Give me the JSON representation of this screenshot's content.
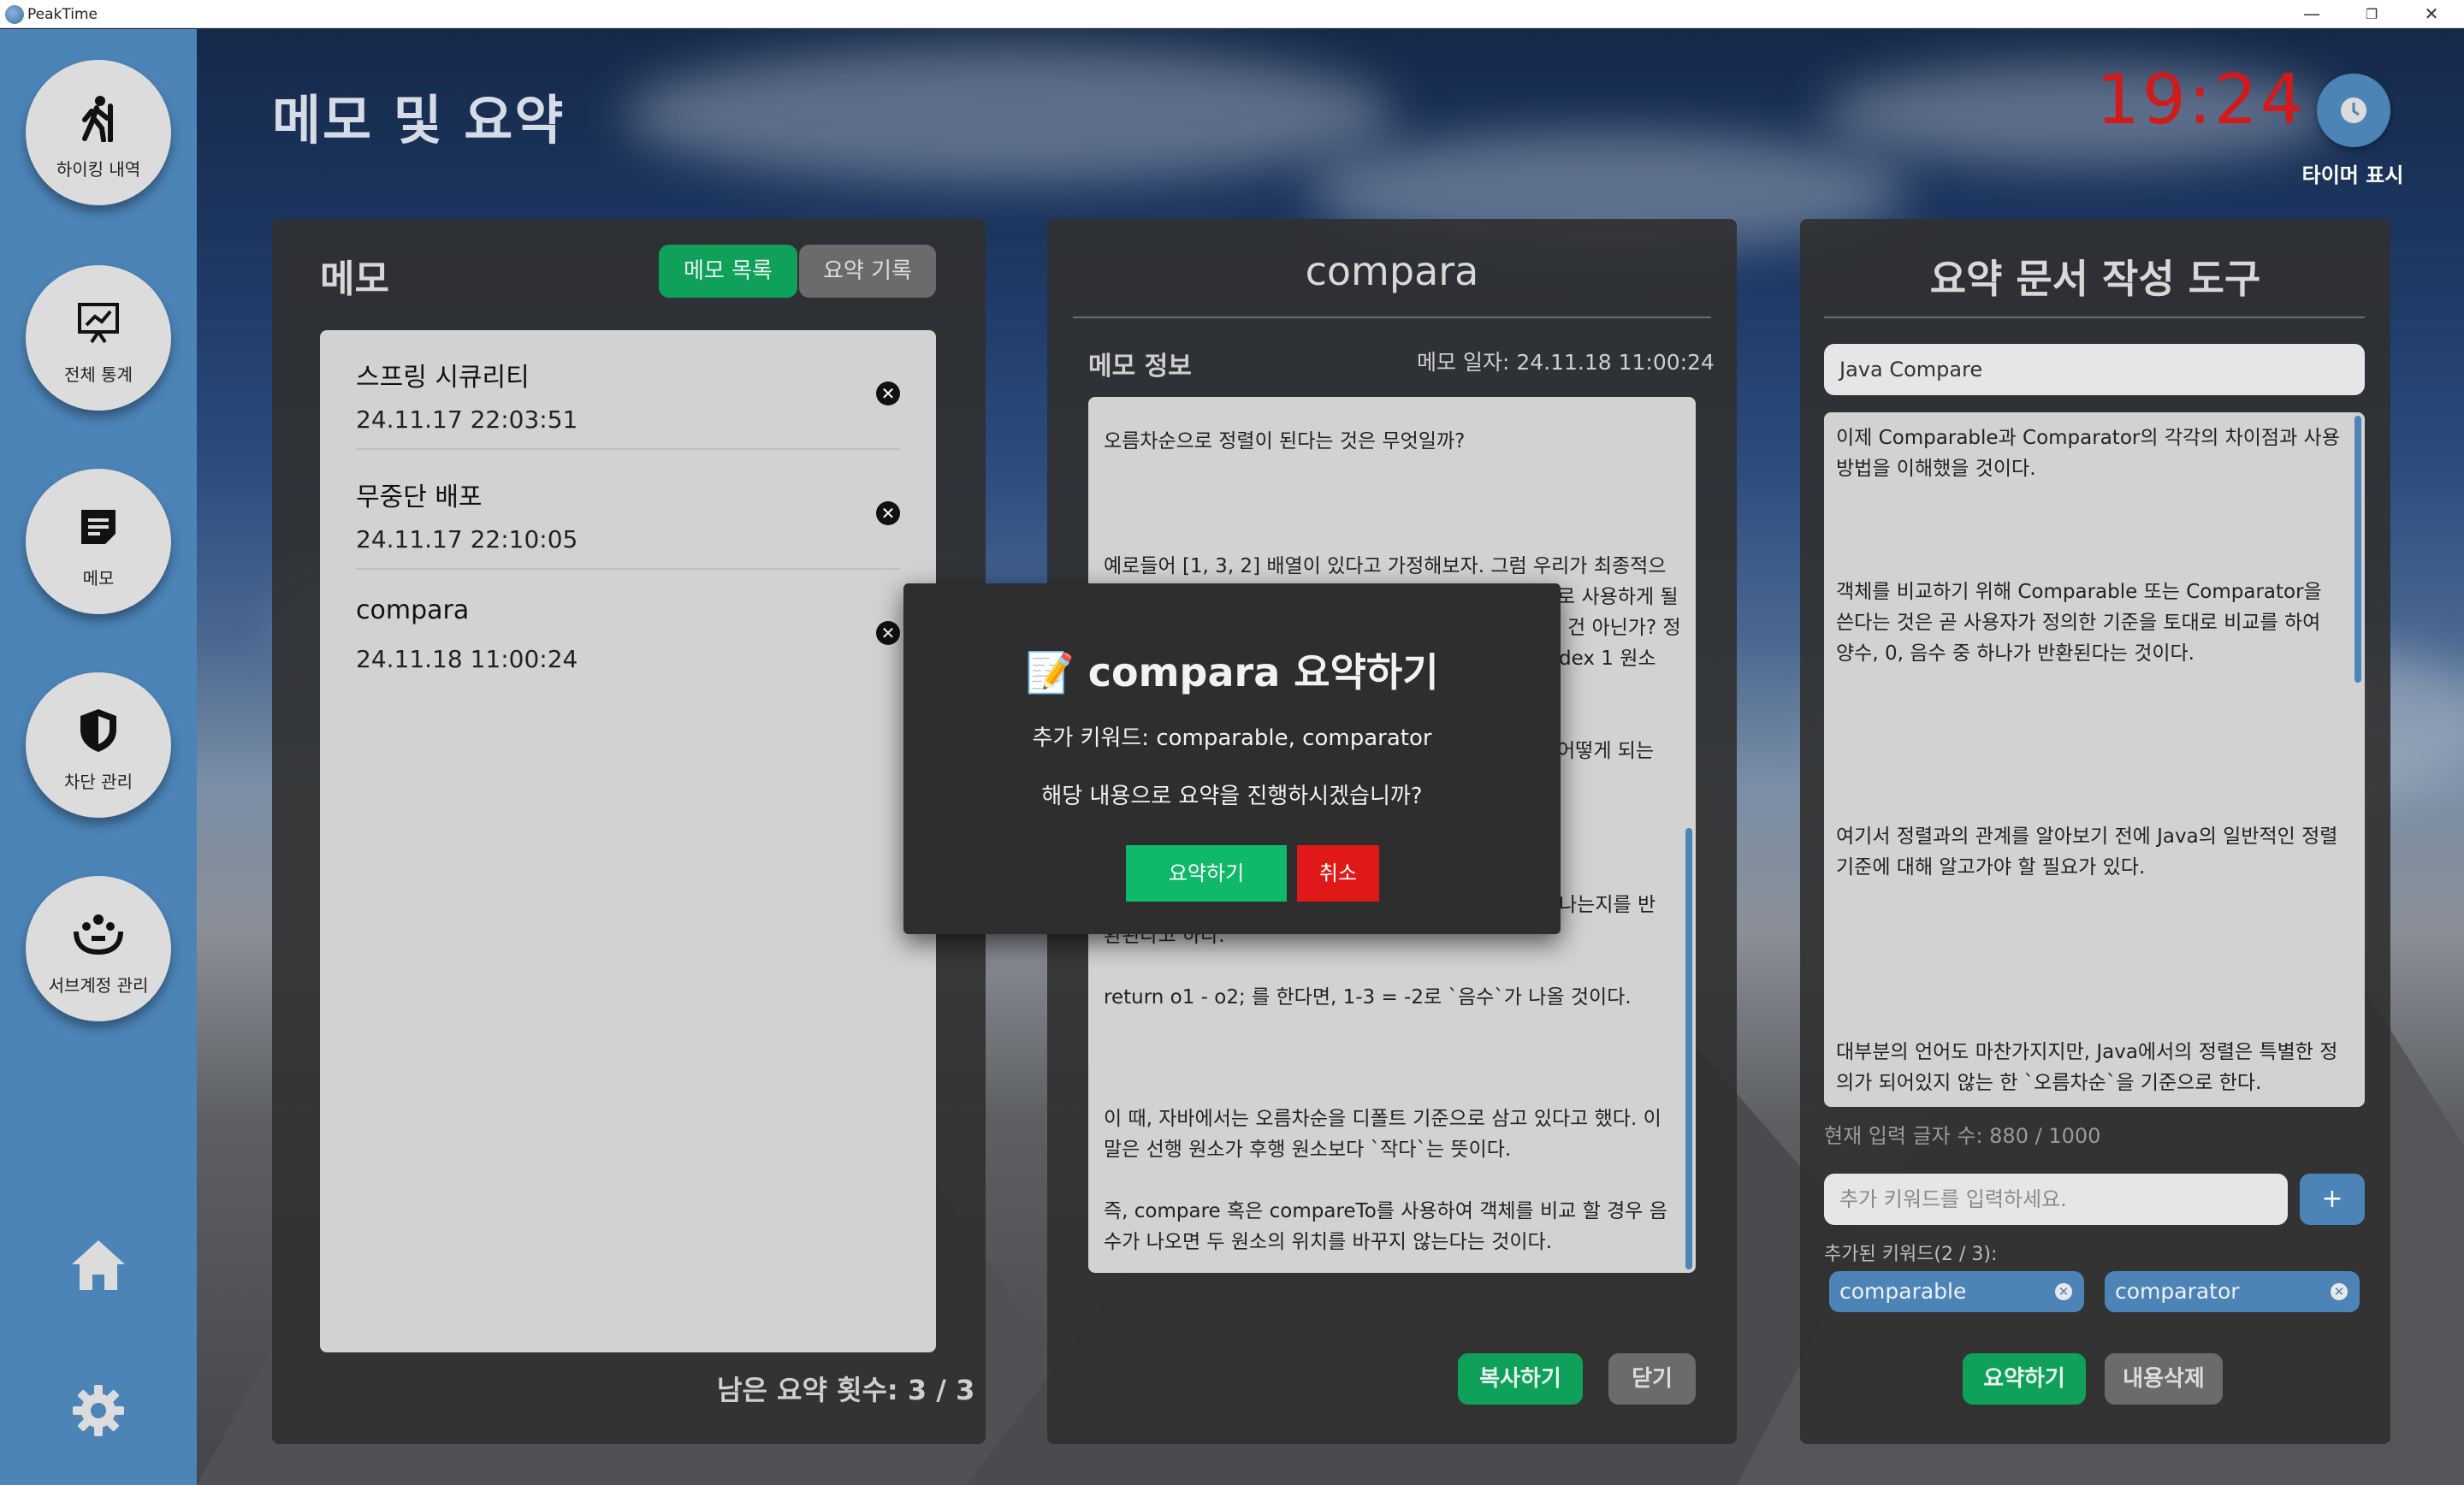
{
  "app": {
    "title": "PeakTime"
  },
  "window_controls": {
    "minimize": "—",
    "restore": "❐",
    "close": "✕"
  },
  "sidebar": {
    "items": [
      {
        "label": "하이킹 내역",
        "icon": "hiker-icon"
      },
      {
        "label": "전체 통계",
        "icon": "chart-board-icon"
      },
      {
        "label": "메모",
        "icon": "memo-icon"
      },
      {
        "label": "차단 관리",
        "icon": "shield-icon"
      },
      {
        "label": "서브계정 관리",
        "icon": "group-hands-icon"
      }
    ],
    "bottom": [
      {
        "icon": "home-icon"
      },
      {
        "icon": "gear-icon"
      }
    ]
  },
  "header": {
    "title": "메모 및 요약",
    "clock": "19:24",
    "timer_label": "타이머 표시",
    "clock_color": "#d11a1a"
  },
  "memo_panel": {
    "title": "메모",
    "tabs": [
      {
        "label": "메모 목록",
        "active": true
      },
      {
        "label": "요약 기록",
        "active": false
      }
    ],
    "items": [
      {
        "title": "스프링 시큐리티",
        "date": "24.11.17 22:03:51"
      },
      {
        "title": "무중단 배포",
        "date": "24.11.17 22:10:05"
      },
      {
        "title": "compara",
        "date": "24.11.18 11:00:24"
      }
    ],
    "delete_symbol": "✕",
    "remaining": "남은 요약 횟수: 3 / 3"
  },
  "detail_panel": {
    "title": "compara",
    "info_label": "메모 정보",
    "date": "메모 일자: 24.11.18 11:00:24",
    "paragraphs": [
      "오름차순으로 정렬이 된다는 것은 무엇일까?",
      "예로들어 [1, 3, 2] 배열이 있다고 가정해보자. 그럼 우리가 최종적으",
      "로 사용하게 될",
      "건 아닌가? 정",
      "dex 1 원소",
      "어떻게 되는",
      "나는지를 반",
      "환된다고 하다.",
      "return o1 - o2; 를 한다면, 1-3 = -2로 `음수`가 나올 것이다.",
      "이 때, 자바에서는 오름차순을 디폴트 기준으로 삼고 있다고 했다. 이 말은 선행 원소가 후행 원소보다 `작다`는 뜻이다.",
      "즉, compare 혹은 compareTo를 사용하여 객체를 비교 할 경우 음수가 나오면 두 원소의 위치를 바꾸지 않는다는 것이다."
    ],
    "copy_button": "복사하기",
    "close_button": "닫기"
  },
  "tool_panel": {
    "title": "요약 문서 작성 도구",
    "doc_title_value": "Java Compare",
    "body_paragraphs": [
      "이제 Comparable과 Comparator의 각각의 차이점과 사용 방법을 이해했을 것이다.",
      "객체를 비교하기 위해 Comparable 또는 Comparator을 쓴다는 것은 곧 사용자가 정의한 기준을 토대로 비교를 하여 양수, 0, 음수 중 하나가 반환된다는 것이다.",
      "여기서 정렬과의 관계를 알아보기 전에 Java의 일반적인 정렬 기준에 대해 알고가야 할 필요가 있다.",
      "대부분의 언어도 마찬가지지만, Java에서의 정렬은 특별한 정의가 되어있지 않는 한 `오름차순`을 기준으로 한다."
    ],
    "char_count": "현재 입력 글자 수: 880 / 1000",
    "keyword_placeholder": "추가 키워드를 입력하세요.",
    "add_button": "+",
    "keywords_label": "추가된 키워드(2 / 3):",
    "keywords": [
      "comparable",
      "comparator"
    ],
    "summarize_button": "요약하기",
    "clear_button": "내용삭제"
  },
  "modal": {
    "title": "📝 compara 요약하기",
    "keywords_line": "추가 키워드: comparable, comparator",
    "question": "해당 내용으로 요약을 진행하시겠습니까?",
    "confirm": "요약하기",
    "cancel": "취소"
  },
  "colors": {
    "accent": "#4c84b8",
    "green": "#0fa15a",
    "confirm_green": "#10b86a",
    "cancel_red": "#e01818"
  }
}
